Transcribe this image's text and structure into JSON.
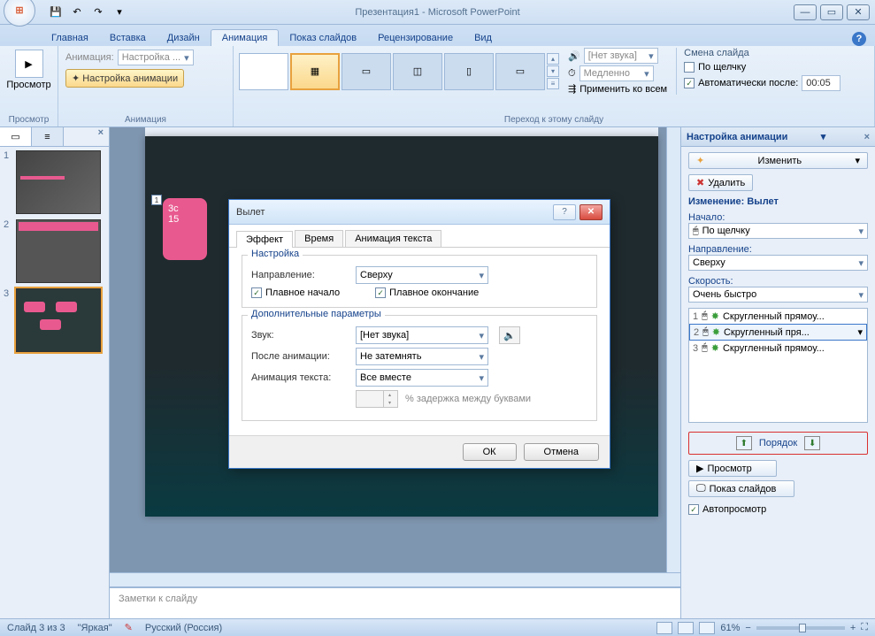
{
  "title": "Презентация1 - Microsoft PowerPoint",
  "tabs": {
    "home": "Главная",
    "insert": "Вставка",
    "design": "Дизайн",
    "animation": "Анимация",
    "slideshow": "Показ слайдов",
    "review": "Рецензирование",
    "view": "Вид"
  },
  "ribbon": {
    "preview_btn": "Просмотр",
    "preview_group": "Просмотр",
    "anim_label": "Анимация:",
    "anim_combo": "Настройка ...",
    "anim_settings_btn": "Настройка анимации",
    "anim_group": "Анимация",
    "sound_combo": "[Нет звука]",
    "speed_combo": "Медленно",
    "apply_all": "Применить ко всем",
    "trans_header": "Смена слайда",
    "on_click": "По щелчку",
    "auto_after": "Автоматически после:",
    "auto_time": "00:05",
    "trans_group": "Переход к этому слайду"
  },
  "thumbs": {
    "n1": "1",
    "n2": "2",
    "n3": "3"
  },
  "slide": {
    "box_line1": "3с",
    "box_line2": "15",
    "handle": "1"
  },
  "notes_placeholder": "Заметки к слайду",
  "pane": {
    "title": "Настройка анимации",
    "change_btn": "Изменить",
    "delete_btn": "Удалить",
    "change_hdr": "Изменение: Вылет",
    "start_label": "Начало:",
    "start_value": "По щелчку",
    "dir_label": "Направление:",
    "dir_value": "Сверху",
    "speed_label": "Скорость:",
    "speed_value": "Очень быстро",
    "effects": [
      {
        "n": "1",
        "name": "Скругленный прямоу..."
      },
      {
        "n": "2",
        "name": "Скругленный пря..."
      },
      {
        "n": "3",
        "name": "Скругленный прямоу..."
      }
    ],
    "order_label": "Порядок",
    "play_btn": "Просмотр",
    "slideshow_btn": "Показ слайдов",
    "autopreview": "Автопросмотр"
  },
  "dialog": {
    "title": "Вылет",
    "tabs": {
      "effect": "Эффект",
      "timing": "Время",
      "text_anim": "Анимация текста"
    },
    "fs1_legend": "Настройка",
    "direction_label": "Направление:",
    "direction_value": "Сверху",
    "smooth_start": "Плавное начало",
    "smooth_end": "Плавное окончание",
    "fs2_legend": "Дополнительные параметры",
    "sound_label": "Звук:",
    "sound_value": "[Нет звука]",
    "after_label": "После анимации:",
    "after_value": "Не затемнять",
    "text_label": "Анимация текста:",
    "text_value": "Все вместе",
    "delay_label": "% задержка между буквами",
    "ok": "ОК",
    "cancel": "Отмена"
  },
  "status": {
    "slide_of": "Слайд 3 из 3",
    "theme": "\"Яркая\"",
    "lang": "Русский (Россия)",
    "zoom": "61%"
  }
}
